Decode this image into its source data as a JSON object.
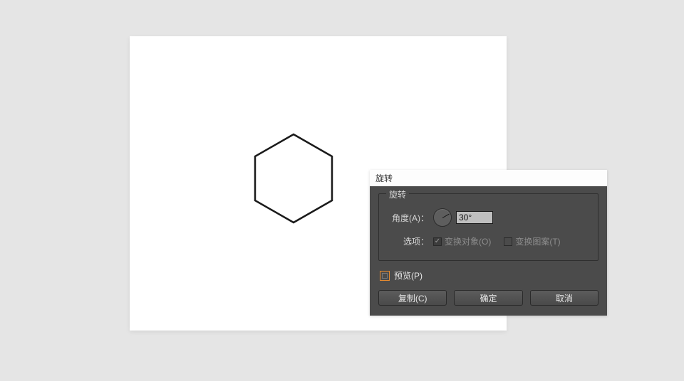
{
  "dialog": {
    "window_title": "旋转",
    "group_title": "旋转",
    "angle_label": "角度(A)：",
    "angle_value": "30°",
    "options_label": "选项：",
    "transform_objects_label": "变换对象(O)",
    "transform_patterns_label": "变换图案(T)",
    "preview_label": "预览(P)",
    "copy_button": "复制(C)",
    "ok_button": "确定",
    "cancel_button": "取消"
  }
}
